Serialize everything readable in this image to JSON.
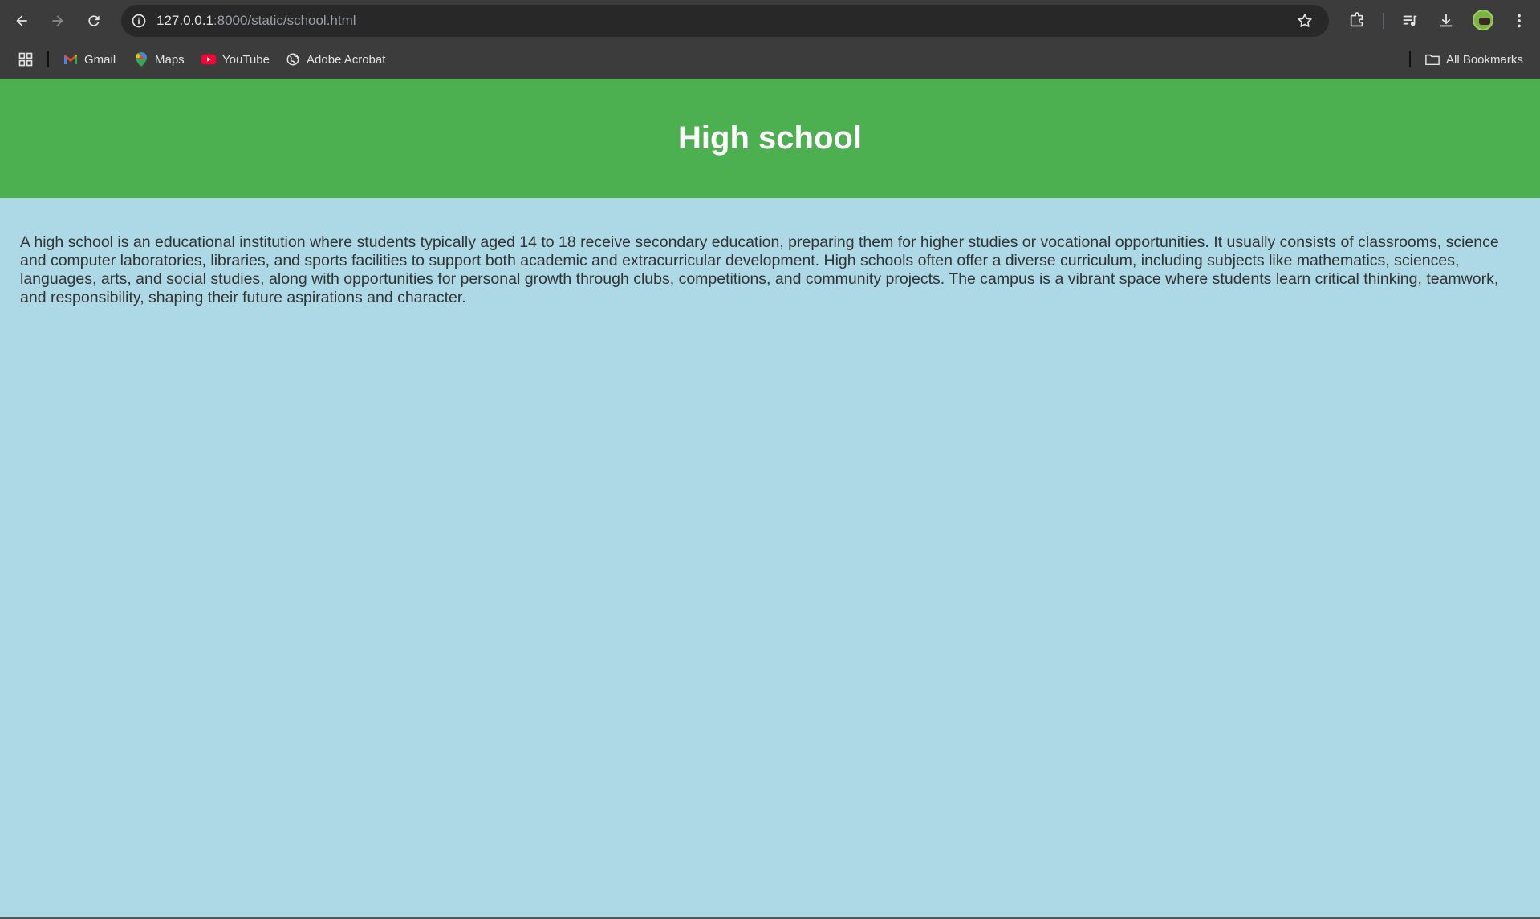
{
  "browser": {
    "url_host": "127.0.0.1",
    "url_rest": ":8000/static/school.html",
    "bookmarks": [
      {
        "label": "Gmail"
      },
      {
        "label": "Maps"
      },
      {
        "label": "YouTube"
      },
      {
        "label": "Adobe Acrobat"
      }
    ],
    "all_bookmarks_label": "All Bookmarks"
  },
  "page": {
    "title": "High school",
    "paragraph": "A high school is an educational institution where students typically aged 14 to 18 receive secondary education, preparing them for higher studies or vocational opportunities. It usually consists of classrooms, science and computer laboratories, libraries, and sports facilities to support both academic and extracurricular development. High schools often offer a diverse curriculum, including subjects like mathematics, sciences, languages, arts, and social studies, along with opportunities for personal growth through clubs, competitions, and community projects. The campus is a vibrant space where students learn critical thinking, teamwork, and responsibility, shaping their future aspirations and character."
  },
  "colors": {
    "header_bg": "#4caf50",
    "body_bg": "#add8e6",
    "chrome_bg": "#3c3c3c"
  }
}
